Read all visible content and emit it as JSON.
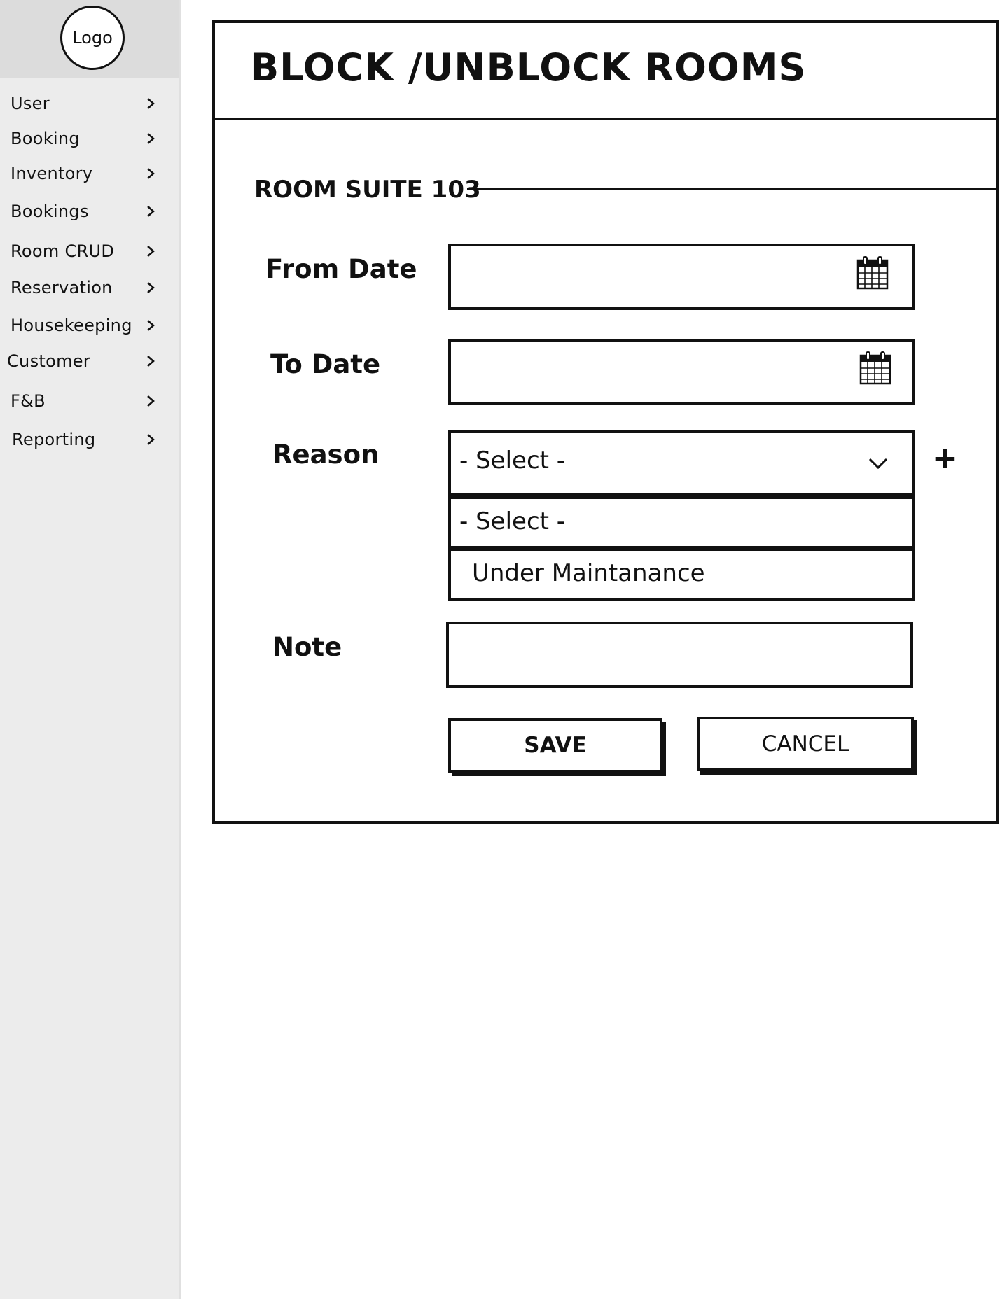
{
  "sidebar": {
    "logo_label": "Logo",
    "items": [
      {
        "label": "User"
      },
      {
        "label": "Booking"
      },
      {
        "label": "Inventory"
      },
      {
        "label": "Bookings"
      },
      {
        "label": "Room CRUD"
      },
      {
        "label": "Reservation"
      },
      {
        "label": "Housekeeping"
      },
      {
        "label": "Customer"
      },
      {
        "label": "F&B"
      },
      {
        "label": "Reporting"
      }
    ]
  },
  "page": {
    "title": "BLOCK /UNBLOCK ROOMS",
    "section_title": "ROOM SUITE 103"
  },
  "form": {
    "from_date": {
      "label": "From Date",
      "value": ""
    },
    "to_date": {
      "label": "To Date",
      "value": ""
    },
    "reason": {
      "label": "Reason",
      "selected": "- Select -",
      "options": [
        "- Select -",
        "Under Maintanance"
      ],
      "expanded": true
    },
    "note": {
      "label": "Note",
      "value": ""
    },
    "save_label": "SAVE",
    "cancel_label": "CANCEL"
  },
  "icons": {
    "calendar": "calendar-icon",
    "chevron_right": "chevron-right-icon",
    "chevron_down": "chevron-down-icon",
    "add": "plus-icon",
    "add_glyph": "+"
  },
  "colors": {
    "sidebar_bg": "#ececec",
    "sidebar_header_bg": "#dcdcdc",
    "ink": "#111111"
  }
}
